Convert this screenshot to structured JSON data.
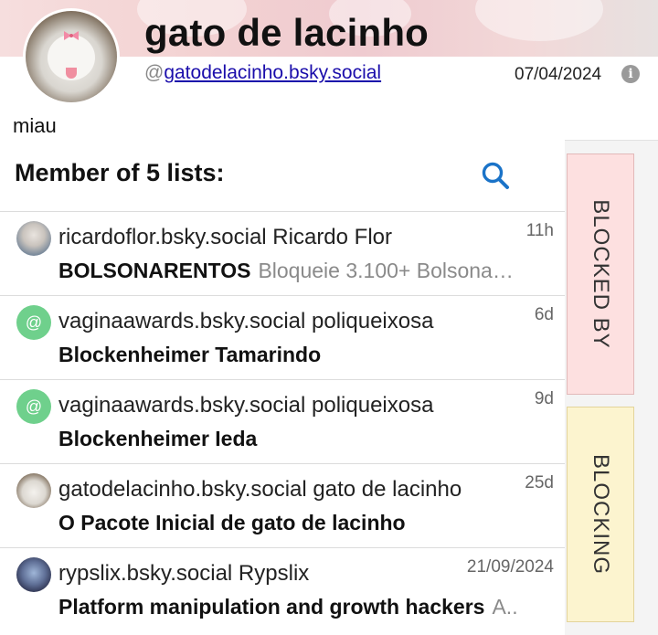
{
  "profile": {
    "display_name": "gato de lacinho",
    "handle_prefix": "@",
    "handle": "gatodelacinho.bsky.social",
    "date": "07/04/2024",
    "bio": "miau"
  },
  "lists_section": {
    "title": "Member of 5 lists:"
  },
  "lists": [
    {
      "owner": "ricardoflor.bsky.social Ricardo Flor",
      "time": "11h",
      "name": "BOLSONARENTOS",
      "description": "Bloqueie 3.100+ Bolsona…",
      "avatar": "photo"
    },
    {
      "owner": "vaginaawards.bsky.social poliqueixosa",
      "time": "6d",
      "name": "Blockenheimer Tamarindo",
      "description": "",
      "avatar": "at"
    },
    {
      "owner": "vaginaawards.bsky.social poliqueixosa",
      "time": "9d",
      "name": "Blockenheimer Ieda",
      "description": "",
      "avatar": "at"
    },
    {
      "owner": "gatodelacinho.bsky.social gato de lacinho",
      "time": "25d",
      "name": "O Pacote Inicial de gato de lacinho",
      "description": "",
      "avatar": "photo"
    },
    {
      "owner": "rypslix.bsky.social Rypslix",
      "time": "21/09/2024",
      "name": "Platform manipulation and growth hackers",
      "description": "A..",
      "avatar": "photo"
    }
  ],
  "side_tabs": {
    "blocked_by": "BLOCKED BY",
    "blocking": "BLOCKING"
  },
  "colors": {
    "at_avatar": "#6fd08c",
    "search_icon": "#1a73c8",
    "blocked_by_bg": "#fde0e0",
    "blocking_bg": "#fcf4cf"
  },
  "icons": {
    "info": "info-icon",
    "search": "search-icon",
    "at": "at-icon"
  }
}
